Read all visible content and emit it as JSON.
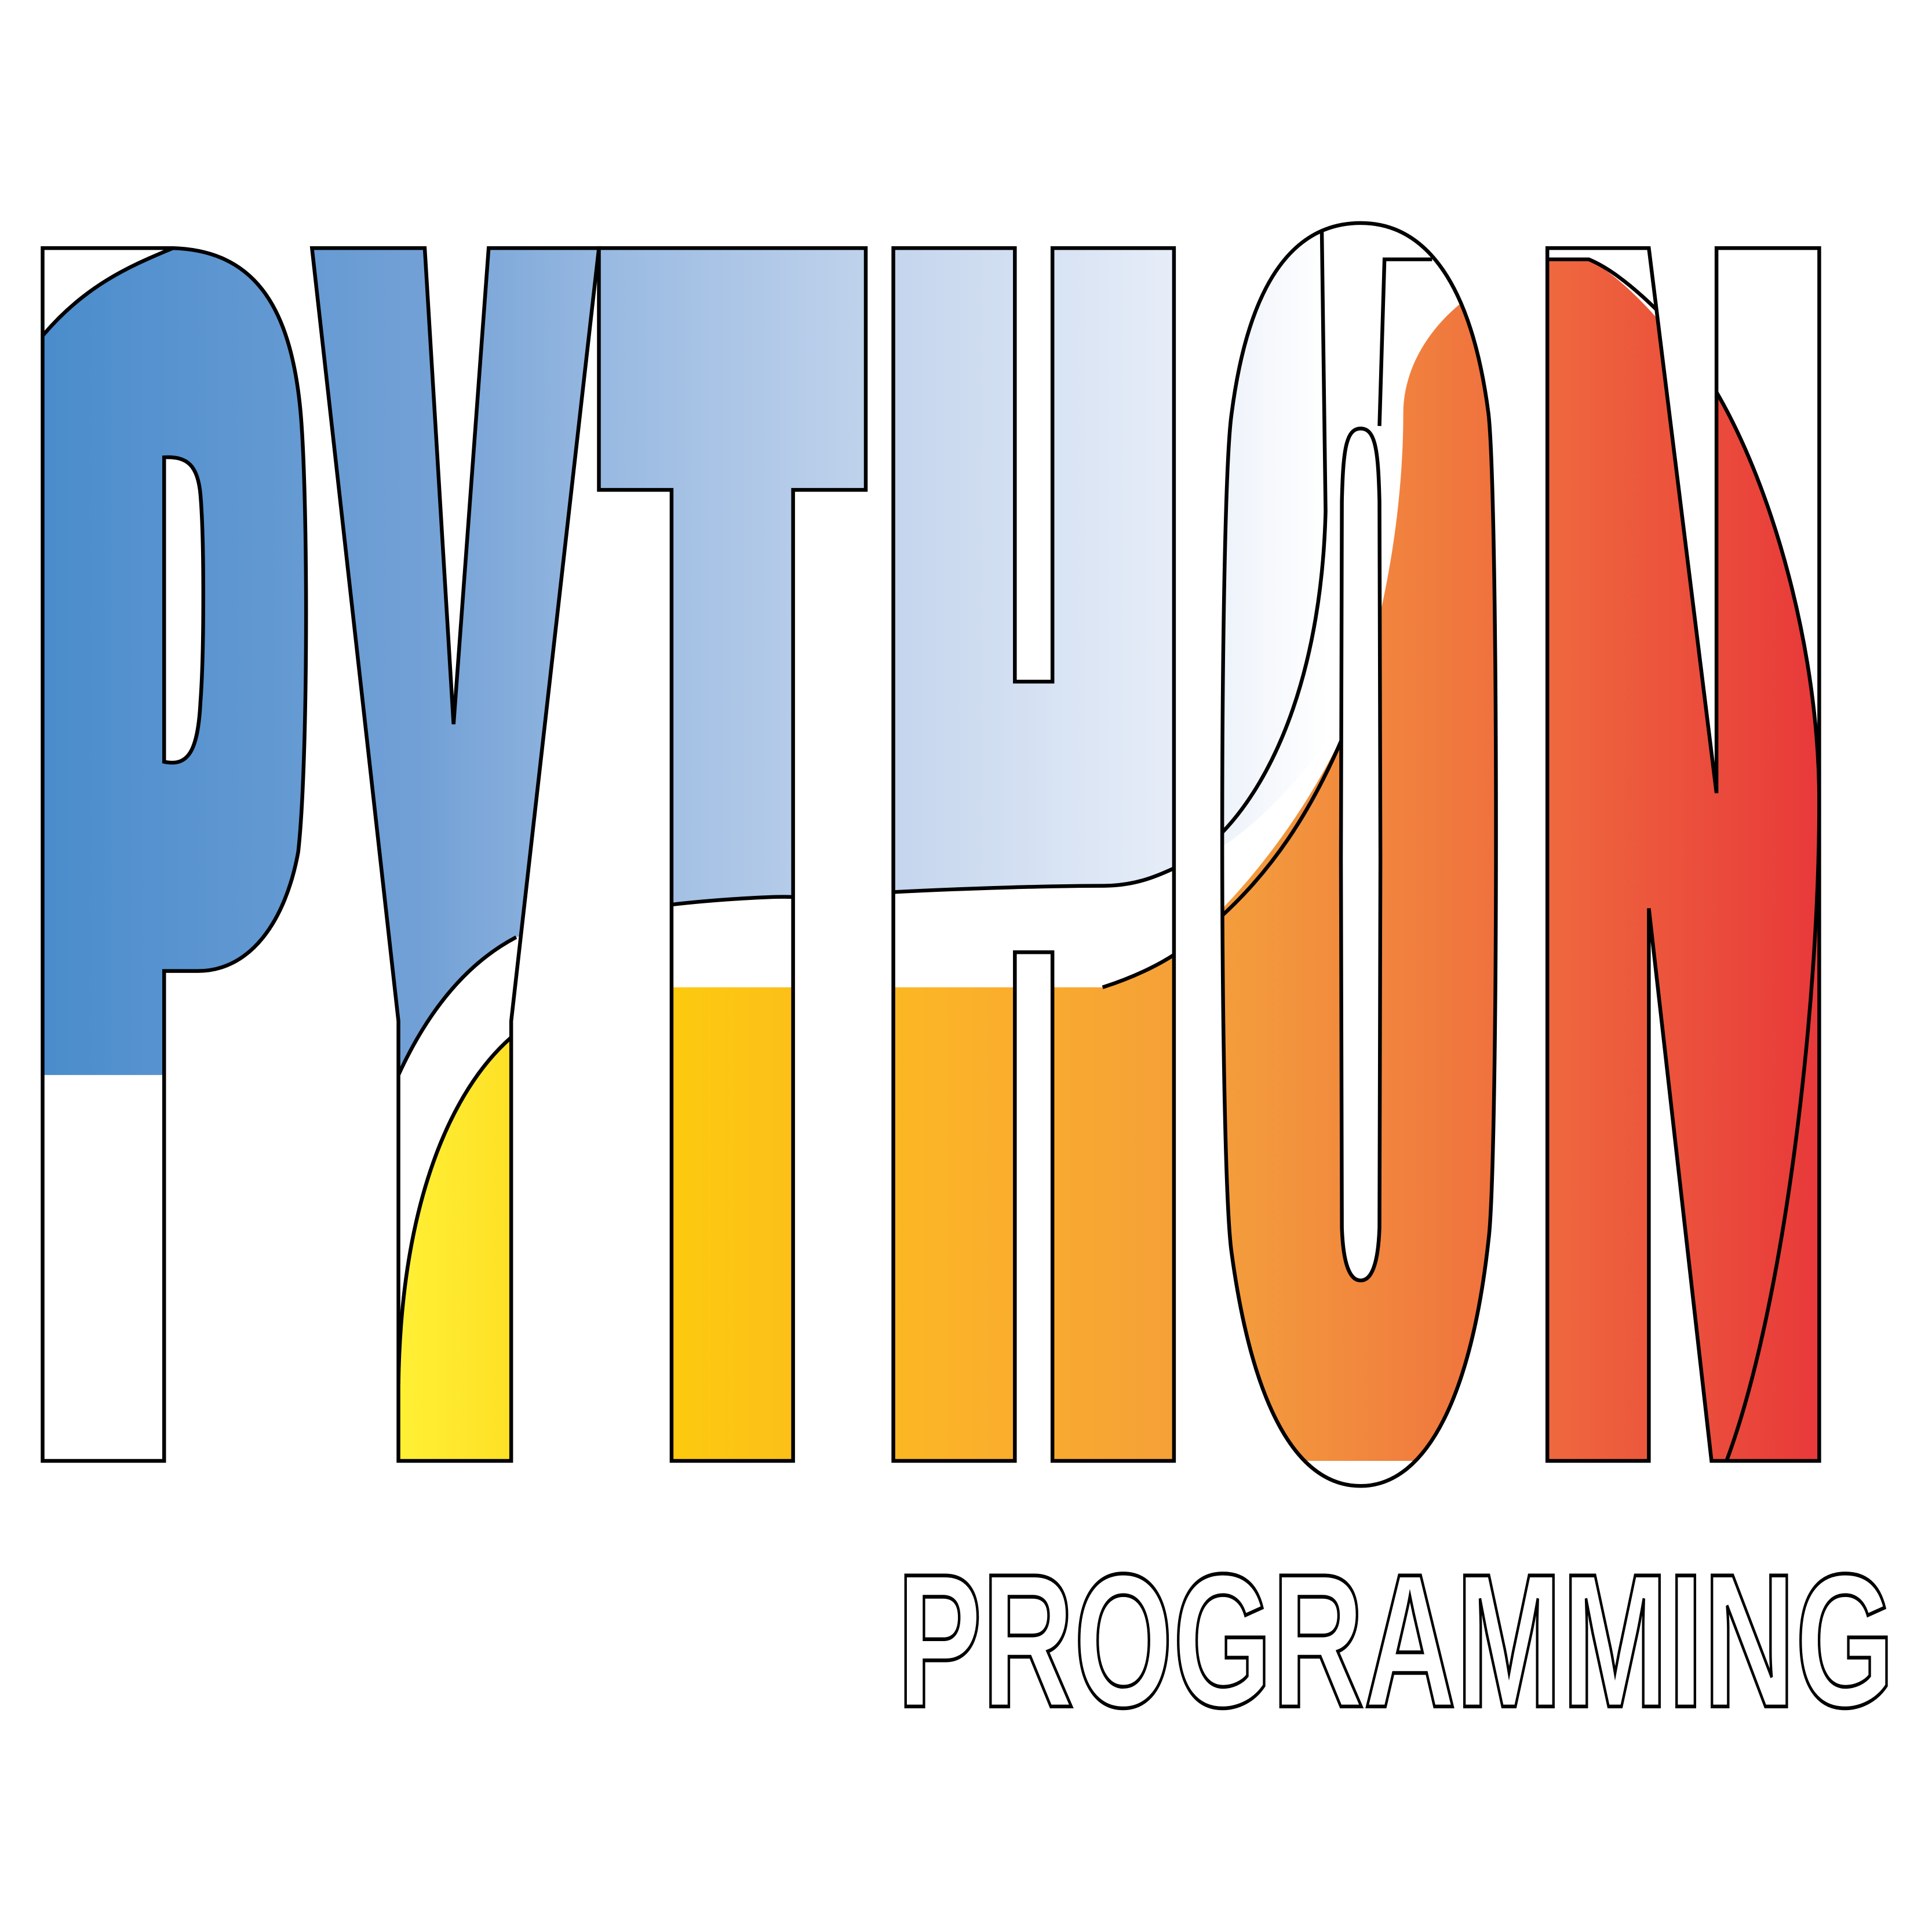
{
  "logo": {
    "title_letters": [
      "P",
      "Y",
      "T",
      "H",
      "O",
      "N"
    ],
    "subtitle": "PROGRAMMING"
  },
  "colors": {
    "blue_dark": "#4a8ccc",
    "blue_mid": "#7aa6d9",
    "blue_light": "#c3d4ec",
    "blue_pale": "#f4f7fc",
    "yellow": "#fff035",
    "yellow_deep": "#fdc90f",
    "orange_light": "#fbb12a",
    "orange": "#f39a3d",
    "orange_red": "#ef6b3e",
    "red": "#e8393a",
    "outline": "#000000",
    "background": "#ffffff"
  },
  "icons": {
    "wave": "white-wave-divider"
  }
}
